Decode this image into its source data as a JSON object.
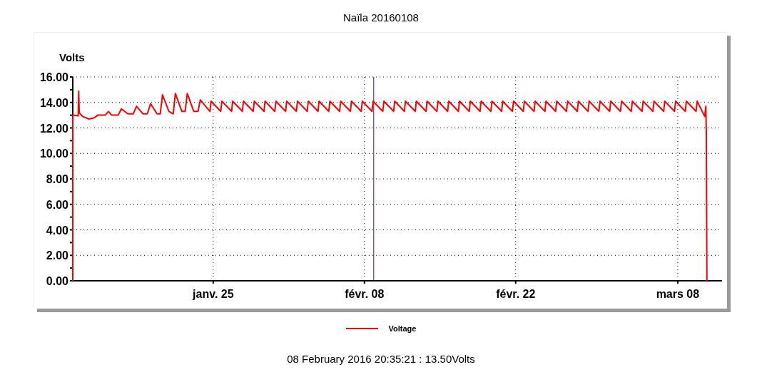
{
  "title": "Naïla 20160108",
  "chart_data": {
    "type": "line",
    "ylabel": "Volts",
    "ylim": [
      0,
      16
    ],
    "xlim": [
      "2016-01-12T00:00",
      "2016-03-12T07:12"
    ],
    "yticks": [
      {
        "value": 0,
        "label": "0.00"
      },
      {
        "value": 2,
        "label": "2.00"
      },
      {
        "value": 4,
        "label": "4.00"
      },
      {
        "value": 6,
        "label": "6.00"
      },
      {
        "value": 8,
        "label": "8.00"
      },
      {
        "value": 10,
        "label": "10.00"
      },
      {
        "value": 12,
        "label": "12.00"
      },
      {
        "value": 14,
        "label": "14.00"
      },
      {
        "value": 16,
        "label": "16.00"
      }
    ],
    "xticks": [
      {
        "value": "2016-01-25",
        "label": "janv. 25"
      },
      {
        "value": "2016-02-08",
        "label": "févr. 08"
      },
      {
        "value": "2016-02-22",
        "label": "févr. 22"
      },
      {
        "value": "2016-03-08",
        "label": "mars 08"
      }
    ],
    "x": [
      "2016-01-12T00:00",
      "2016-01-12T00:00",
      "2016-01-12T12:00",
      "2016-01-12T13:12",
      "2016-01-12T14:24",
      "2016-01-12T21:36",
      "2016-01-13T12:00",
      "2016-01-14T00:00",
      "2016-01-14T07:12",
      "2016-01-15T00:00",
      "2016-01-15T07:12",
      "2016-01-15T14:24",
      "2016-01-16T04:48",
      "2016-01-16T12:00",
      "2016-01-17T02:24",
      "2016-01-17T14:24",
      "2016-01-17T21:36",
      "2016-01-18T12:00",
      "2016-01-18T21:36",
      "2016-01-19T04:48",
      "2016-01-19T19:12",
      "2016-01-20T02:24",
      "2016-01-20T07:12",
      "2016-01-20T21:36",
      "2016-01-21T07:12",
      "2016-01-21T12:00",
      "2016-01-22T02:24",
      "2016-01-22T09:36",
      "2016-01-22T14:24",
      "2016-01-23T04:48",
      "2016-01-23T14:24",
      "2016-01-23T19:12",
      "2016-01-24T16:48",
      "2016-01-24T19:12",
      "2016-01-25T16:48",
      "2016-01-25T19:12",
      "2016-01-26T16:48",
      "2016-01-26T19:12",
      "2016-01-27T16:48",
      "2016-01-27T19:12",
      "2016-01-28T16:48",
      "2016-01-28T19:12",
      "2016-01-29T16:48",
      "2016-01-29T19:12",
      "2016-01-30T16:48",
      "2016-01-30T19:12",
      "2016-01-31T16:48",
      "2016-01-31T19:12",
      "2016-02-01T16:48",
      "2016-02-01T19:12",
      "2016-02-02T16:48",
      "2016-02-02T19:12",
      "2016-02-03T16:48",
      "2016-02-03T19:12",
      "2016-02-04T16:48",
      "2016-02-04T19:12",
      "2016-02-05T16:48",
      "2016-02-05T19:12",
      "2016-02-06T16:48",
      "2016-02-06T19:12",
      "2016-02-07T16:48",
      "2016-02-07T19:12",
      "2016-02-08T16:48",
      "2016-02-08T19:12",
      "2016-02-09T16:48",
      "2016-02-09T19:12",
      "2016-02-10T16:48",
      "2016-02-10T19:12",
      "2016-02-11T16:48",
      "2016-02-11T19:12",
      "2016-02-12T16:48",
      "2016-02-12T19:12",
      "2016-02-13T16:48",
      "2016-02-13T19:12",
      "2016-02-14T16:48",
      "2016-02-14T19:12",
      "2016-02-15T16:48",
      "2016-02-15T19:12",
      "2016-02-16T16:48",
      "2016-02-16T19:12",
      "2016-02-17T16:48",
      "2016-02-17T19:12",
      "2016-02-18T16:48",
      "2016-02-18T19:12",
      "2016-02-19T16:48",
      "2016-02-19T19:12",
      "2016-02-20T16:48",
      "2016-02-20T19:12",
      "2016-02-21T16:48",
      "2016-02-21T19:12",
      "2016-02-22T16:48",
      "2016-02-22T19:12",
      "2016-02-23T16:48",
      "2016-02-23T19:12",
      "2016-02-24T16:48",
      "2016-02-24T19:12",
      "2016-02-25T16:48",
      "2016-02-25T19:12",
      "2016-02-26T16:48",
      "2016-02-26T19:12",
      "2016-02-27T16:48",
      "2016-02-27T19:12",
      "2016-02-28T16:48",
      "2016-02-28T19:12",
      "2016-02-29T16:48",
      "2016-02-29T19:12",
      "2016-03-01T16:48",
      "2016-03-01T19:12",
      "2016-03-02T16:48",
      "2016-03-02T19:12",
      "2016-03-03T16:48",
      "2016-03-03T19:12",
      "2016-03-04T16:48",
      "2016-03-04T19:12",
      "2016-03-05T16:48",
      "2016-03-05T19:12",
      "2016-03-06T16:48",
      "2016-03-06T19:12",
      "2016-03-07T16:48",
      "2016-03-07T19:12",
      "2016-03-08T16:48",
      "2016-03-08T19:12",
      "2016-03-09T16:48",
      "2016-03-09T19:12",
      "2016-03-10T12:00",
      "2016-03-10T14:24",
      "2016-03-10T15:36",
      "2016-03-10T16:48"
    ],
    "series": [
      {
        "name": "Voltage",
        "color": "#ff0000",
        "values": [
          0,
          13.0,
          12.95,
          14.9,
          13.2,
          12.9,
          12.7,
          12.8,
          13.0,
          13.0,
          13.3,
          13.0,
          13.0,
          13.5,
          13.1,
          13.1,
          13.7,
          13.1,
          13.1,
          13.9,
          13.1,
          13.1,
          14.6,
          13.3,
          13.1,
          14.7,
          13.3,
          13.3,
          14.7,
          13.3,
          13.3,
          14.2,
          13.3,
          14.1,
          13.3,
          14.1,
          13.3,
          14.1,
          13.3,
          14.1,
          13.3,
          14.1,
          13.3,
          14.1,
          13.3,
          14.1,
          13.3,
          14.1,
          13.3,
          14.1,
          13.3,
          14.1,
          13.3,
          14.1,
          13.3,
          14.1,
          13.3,
          14.1,
          13.3,
          14.1,
          13.3,
          14.1,
          13.3,
          14.1,
          13.3,
          14.1,
          13.3,
          14.1,
          13.3,
          14.1,
          13.3,
          14.1,
          13.3,
          14.1,
          13.3,
          14.1,
          13.3,
          14.1,
          13.3,
          14.1,
          13.3,
          14.1,
          13.3,
          14.1,
          13.3,
          14.1,
          13.3,
          14.1,
          13.3,
          14.1,
          13.3,
          14.1,
          13.3,
          14.1,
          13.3,
          14.1,
          13.3,
          14.1,
          13.3,
          14.1,
          13.3,
          14.1,
          13.3,
          14.1,
          13.3,
          14.1,
          13.3,
          14.1,
          13.3,
          14.1,
          13.3,
          14.1,
          13.3,
          14.1,
          13.3,
          14.1,
          13.3,
          14.1,
          13.3,
          14.1,
          13.3,
          14.1,
          13.3,
          14.1,
          12.9,
          13.7,
          11.6,
          0
        ]
      }
    ],
    "grid": true,
    "ref_lines": [
      {
        "axis": "x",
        "value": "2016-02-08T20:35:21"
      }
    ]
  },
  "readout": "08 February 2016 20:35:21 : 13.50Volts"
}
